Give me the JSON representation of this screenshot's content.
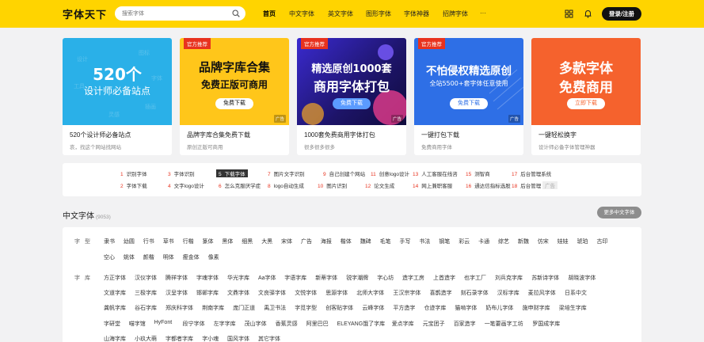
{
  "header": {
    "logo": "字体天下",
    "search_placeholder": "搜索字体",
    "nav": [
      "首页",
      "中文字体",
      "英文字体",
      "图形字体",
      "字体神器",
      "招牌字体",
      "···"
    ],
    "login": "登录/注册",
    "brand_color": "#ffd400"
  },
  "cards": [
    {
      "title": "520个设计师必备站点",
      "desc": "哀，找这个网站找网站",
      "art": {
        "big1": "520个",
        "big2": "设计师必备站点",
        "bg": "#2ab0e8"
      }
    },
    {
      "title": "品牌字库合集免费下载",
      "desc": "原创正版可商用",
      "art": {
        "tag": "官方推荐",
        "big1": "品牌字库合集",
        "big2": "免费正版可商用",
        "button": "免费下载",
        "ad": "广告",
        "bg": "#ffc61a"
      }
    },
    {
      "title": "1000套免费商用字体打包",
      "desc": "很多很多很多",
      "art": {
        "tag": "官方推荐",
        "big1": "精选原创1000套",
        "big2": "商用字体打包",
        "button": "免费下载",
        "ad": "广告",
        "bg": "#2a1f8c"
      }
    },
    {
      "title": "一键打包下载",
      "desc": "免费商用字体",
      "art": {
        "tag": "官方推荐",
        "big1": "不怕侵权精选原创",
        "big2": "全站5500+套字体任意使用",
        "button": "免费下载",
        "ad": "广告",
        "bg": "#2e6fe6"
      }
    },
    {
      "title": "一键轻松换字",
      "desc": "设计师必备字体管理神器",
      "art": {
        "big1": "多款字体",
        "big2": "免费商用",
        "button": "立即下载",
        "bg": "#f5622d"
      }
    }
  ],
  "hot_words": [
    {
      "n": "1",
      "t": "识别字体"
    },
    {
      "n": "3",
      "t": "字体识别"
    },
    {
      "n": "5",
      "t": "下载字体"
    },
    {
      "n": "7",
      "t": "图片文字识别"
    },
    {
      "n": "9",
      "t": "自己创建个网站"
    },
    {
      "n": "11",
      "t": "创意logo设计"
    },
    {
      "n": "13",
      "t": "人工客服在线咨"
    },
    {
      "n": "15",
      "t": "测智商"
    },
    {
      "n": "17",
      "t": "后台管理系统"
    },
    {
      "n": "2",
      "t": "字体下载"
    },
    {
      "n": "4",
      "t": "文字logo设计"
    },
    {
      "n": "6",
      "t": "怎么克服厌学症"
    },
    {
      "n": "8",
      "t": "logo自动生成"
    },
    {
      "n": "10",
      "t": "图片识别"
    },
    {
      "n": "12",
      "t": "论文生成"
    },
    {
      "n": "14",
      "t": "网上兼职客服"
    },
    {
      "n": "16",
      "t": "通达信指标选股"
    },
    {
      "n": "18",
      "t": "后台管理"
    }
  ],
  "hot_tail": "广告",
  "section": {
    "title": "中文字体",
    "count": "(9053)",
    "more": "更多中文字体",
    "type_label": "字型",
    "lib_label": "字库",
    "types_row1": [
      "隶书",
      "幼圆",
      "行书",
      "草书",
      "行楷",
      "篆体",
      "黑体",
      "细黑",
      "大黑",
      "宋体",
      "广告",
      "海报",
      "楷体",
      "魏碑",
      "毛笔",
      "手写",
      "书法",
      "钢笔",
      "彩云",
      "卡通",
      "综艺",
      "新魏",
      "仿宋",
      "娃娃",
      "琥珀",
      "古印"
    ],
    "types_row2": [
      "空心",
      "姚体",
      "颜楷",
      "明体",
      "瘦金体",
      "像素"
    ],
    "libs_row1": [
      "方正字体",
      "汉仪字体",
      "腾祥字体",
      "字魂字体",
      "华光字库",
      "Aa字体",
      "字语字库",
      "新蒂字体",
      "锐字潮牌",
      "字心坊",
      "造字工房",
      "上首造字",
      "也字工厂",
      "刘兵克字库",
      "苏新诗字体",
      "胡晓波字体"
    ],
    "libs_row2": [
      "文道字库",
      "三极字库",
      "汉呈字体",
      "邯郸字库",
      "文鼎字体",
      "文良驿字体",
      "文悦字体",
      "思源字体",
      "北师大字体",
      "王汉宗字体",
      "喜鹊造字",
      "刻石录字体",
      "汉标字库",
      "麦拉风字体",
      "日系中文"
    ],
    "libs_row3": [
      "龚帆字库",
      "谷石字库",
      "郑庆科字体",
      "荆南字库",
      "庞门正道",
      "禹卫书法",
      "字觅字型",
      "创客贴字体",
      "云峰字体",
      "平方造字",
      "仓迹字库",
      "猫啃字体",
      "奶布儿字体",
      "施申财字库",
      "梁培生字库"
    ],
    "libs_row4": [
      "字研堂",
      "喵字馆",
      "HyFont",
      "段宁字体",
      "左字字库",
      "茂山字体",
      "香蕉灵感",
      "阿里巴巴",
      "ELEYANG饿了字库",
      "爱点字库",
      "元宝团子",
      "百家造字",
      "一笔要画字工坊",
      "罗国成字库"
    ],
    "libs_row5": [
      "山海字库",
      "小玖大萌",
      "字都者字库",
      "字小魂",
      "国风字体",
      "其它字体"
    ]
  }
}
